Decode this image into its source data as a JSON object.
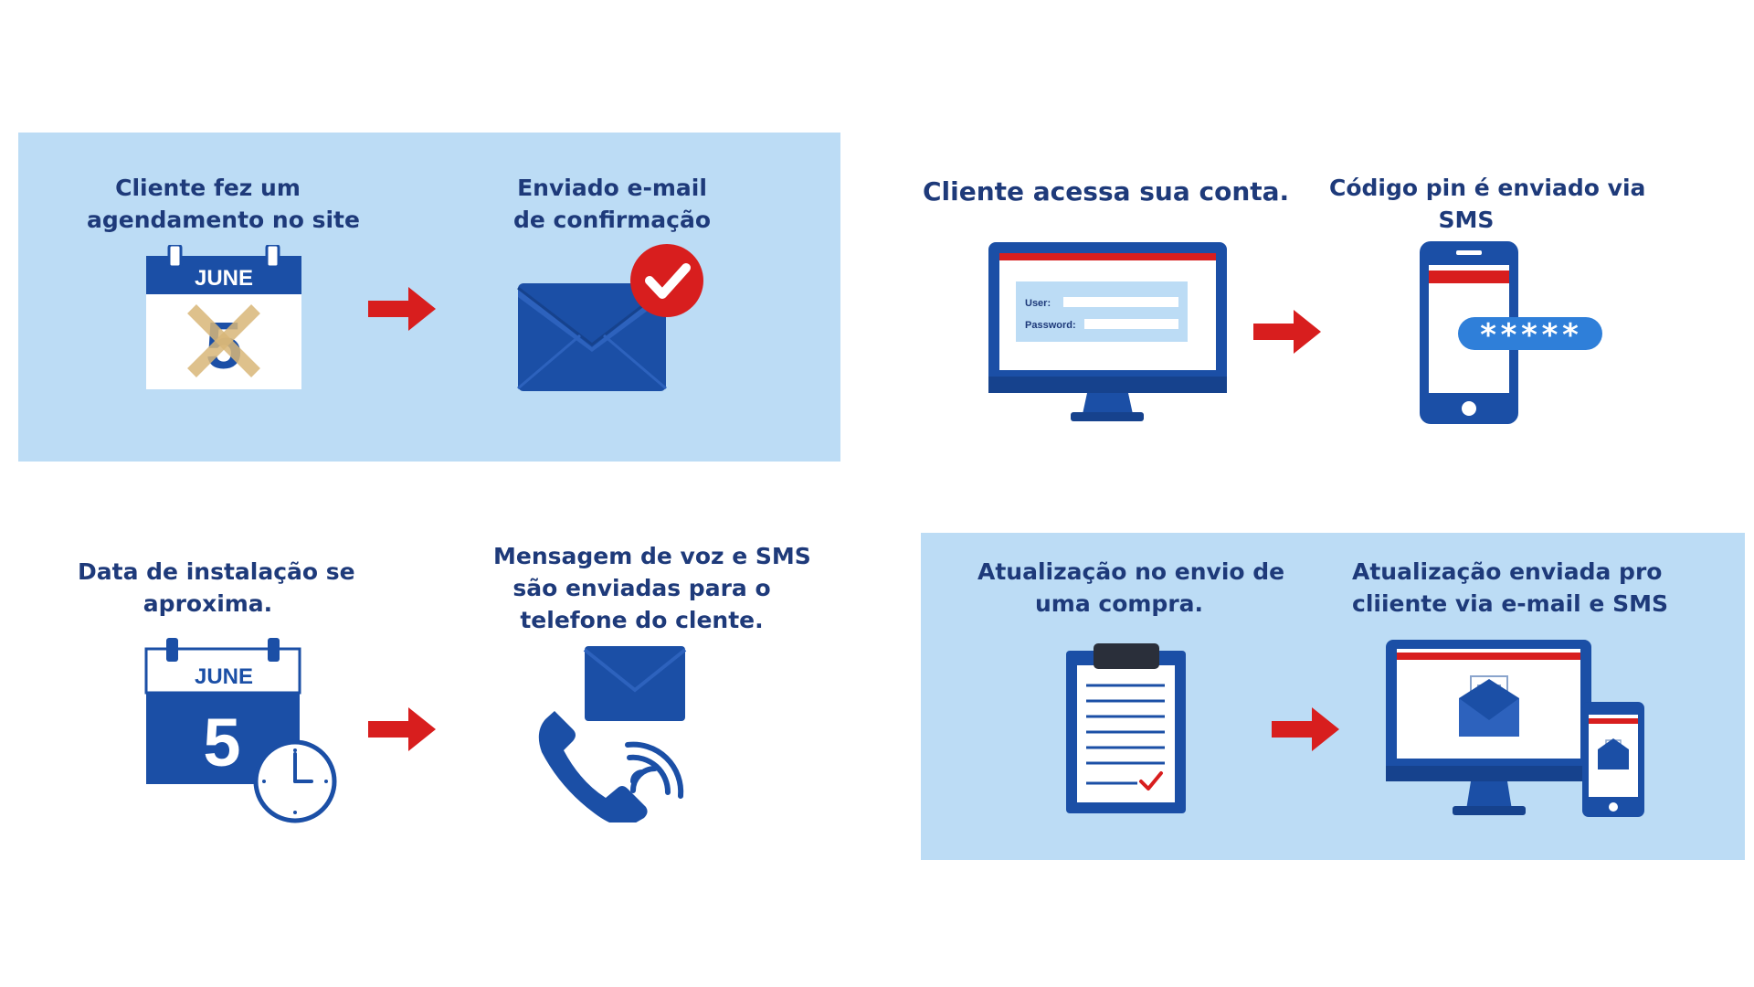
{
  "colors": {
    "panel_bg": "#bcdcf5",
    "navy": "#1e3a7a",
    "blue": "#1b4fa6",
    "red": "#d81e1e",
    "white": "#ffffff"
  },
  "steps": {
    "scheduling": {
      "title": {
        "line1": "Cliente fez um",
        "line2": "agendamento no site"
      },
      "calendar": {
        "month": "JUNE",
        "day": "5"
      },
      "icon": "calendar-crossed-icon"
    },
    "email_confirmation": {
      "title": {
        "line1": "Enviado e-mail",
        "line2": "de confirmação"
      },
      "icon": "envelope-check-icon"
    },
    "account_access": {
      "title": "Cliente acessa sua conta.",
      "login": {
        "user_label": "User:",
        "password_label": "Password:"
      },
      "icon": "monitor-login-icon"
    },
    "pin_sms": {
      "title": {
        "line1": "Código pin é enviado via",
        "line2": "SMS"
      },
      "pin_mask": "*****",
      "icon": "phone-pin-icon"
    },
    "install_date": {
      "title": {
        "line1": "Data de instalação se",
        "line2": "aproxima."
      },
      "calendar": {
        "month": "JUNE",
        "day": "5"
      },
      "icon": "calendar-clock-icon"
    },
    "voice_sms": {
      "title": {
        "line1": "Mensagem de voz e SMS",
        "line2": "são enviadas para o",
        "line3": "telefone do clente."
      },
      "icon": "phone-call-envelope-icon"
    },
    "purchase_update": {
      "title": {
        "line1": "Atualização no envio de",
        "line2": "uma compra."
      },
      "icon": "clipboard-checklist-icon"
    },
    "customer_update": {
      "title": {
        "line1": "Atualização enviada pro",
        "line2": "cliiente via e-mail e SMS"
      },
      "icon": "devices-email-icon"
    }
  },
  "arrow_icon": "right-arrow-icon"
}
